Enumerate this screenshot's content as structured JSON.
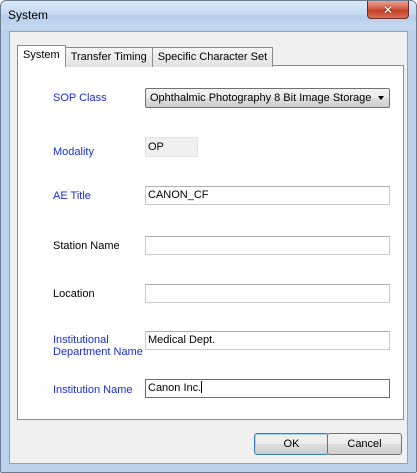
{
  "window": {
    "title": "System",
    "close_glyph": "✕"
  },
  "tabs": [
    {
      "label": "System",
      "active": true
    },
    {
      "label": "Transfer Timing",
      "active": false
    },
    {
      "label": "Specific Character Set",
      "active": false
    }
  ],
  "form": {
    "sop_class": {
      "label": "SOP Class",
      "value": "Ophthalmic Photography 8 Bit Image Storage"
    },
    "modality": {
      "label": "Modality",
      "value": "OP"
    },
    "ae_title": {
      "label": "AE Title",
      "value": "CANON_CF"
    },
    "station_name": {
      "label": "Station Name",
      "value": ""
    },
    "location": {
      "label": "Location",
      "value": ""
    },
    "institutional_department_name": {
      "label_line1": "Institutional",
      "label_line2": "Department Name",
      "value": "Medical Dept."
    },
    "institution_name": {
      "label": "Institution Name",
      "value": "Canon Inc."
    }
  },
  "buttons": {
    "ok": "OK",
    "cancel": "Cancel"
  },
  "colors": {
    "required_label": "#1a2ddb",
    "optional_label": "#000000"
  }
}
